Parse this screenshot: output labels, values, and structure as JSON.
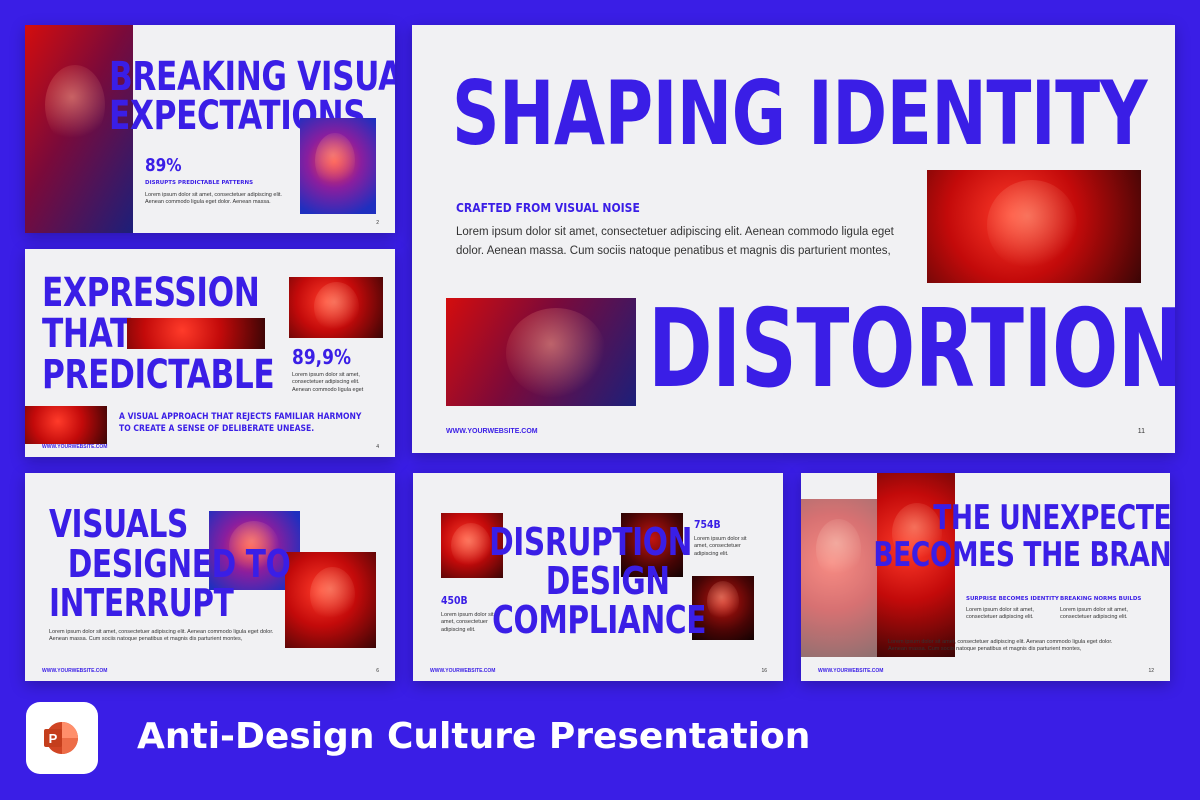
{
  "colors": {
    "background": "#3a1ee6",
    "accent": "#3a1ee6",
    "slide": "#f1f1f3",
    "photo_red": "#c30a0a"
  },
  "slide1": {
    "heading": [
      "BREAKING VISUAL",
      "EXPECTATIONS"
    ],
    "stat": "89%",
    "caption": "DISRUPTS PREDICTABLE PATTERNS",
    "body": [
      "Lorem ipsum dolor sit amet, consectetuer adipiscing elit.",
      "Aenean commodo ligula eget dolor. Aenean massa."
    ],
    "page": "2"
  },
  "slide2": {
    "heading": [
      "EXPRESSION",
      "THAT",
      "PREDICTABLE"
    ],
    "stat": "89,9%",
    "body": [
      "Lorem ipsum dolor sit amet,",
      "consectetuer adipiscing elit.",
      "Aenean commodo ligula eget"
    ],
    "tagline": [
      "A VISUAL APPROACH THAT REJECTS FAMILIAR HARMONY",
      "TO CREATE A SENSE OF DELIBERATE UNEASE."
    ],
    "footer": "WWW.YOURWEBSITE.COM",
    "page": "4"
  },
  "slide3": {
    "heading": [
      "SHAPING IDENTITY",
      "DISTORTION"
    ],
    "subtitle": "CRAFTED FROM VISUAL NOISE",
    "body": [
      "Lorem ipsum dolor sit amet, consectetuer adipiscing elit. Aenean commodo ligula eget",
      "dolor. Aenean massa. Cum sociis natoque penatibus et magnis dis parturient montes,"
    ],
    "footer": "WWW.YOURWEBSITE.COM",
    "page": "11"
  },
  "slide4": {
    "heading": [
      "VISUALS",
      "DESIGNED TO",
      "INTERRUPT"
    ],
    "body": [
      "Lorem ipsum dolor sit amet, consectetuer adipiscing elit. Aenean commodo ligula eget dolor.",
      "Aenean massa. Cum sociis natoque penatibus et magnis dis parturient montes,"
    ],
    "footer": "WWW.YOURWEBSITE.COM",
    "page": "6"
  },
  "slide5": {
    "heading": [
      "DISRUPTION",
      "DESIGN",
      "COMPLIANCE"
    ],
    "stat_a": "754B",
    "stat_a_body": [
      "Lorem ipsum dolor sit",
      "amet, consectetuer",
      "adipiscing elit."
    ],
    "stat_b": "450B",
    "stat_b_body": [
      "Lorem ipsum dolor sit",
      "amet, consectetuer",
      "adipiscing elit."
    ],
    "footer": "WWW.YOURWEBSITE.COM",
    "page": "16"
  },
  "slide6": {
    "heading": [
      "THE UNEXPECTED",
      "BECOMES THE BRAND"
    ],
    "col1_title": "SURPRISE BECOMES IDENTITY",
    "col1_body": [
      "Lorem ipsum dolor sit amet,",
      "consectetuer adipiscing elit."
    ],
    "col2_title": "BREAKING NORMS BUILDS",
    "col2_body": [
      "Lorem ipsum dolor sit amet,",
      "consectetuer adipiscing elit."
    ],
    "body": [
      "Lorem ipsum dolor sit amet, consectetuer adipiscing elit. Aenean commodo ligula eget dolor.",
      "Aenean massa. Cum sociis natoque penatibus et magnis dis parturient montes,"
    ],
    "footer": "WWW.YOURWEBSITE.COM",
    "page": "12"
  },
  "banner": {
    "title": "Anti-Design Culture Presentation",
    "icon": "powerpoint-icon"
  }
}
